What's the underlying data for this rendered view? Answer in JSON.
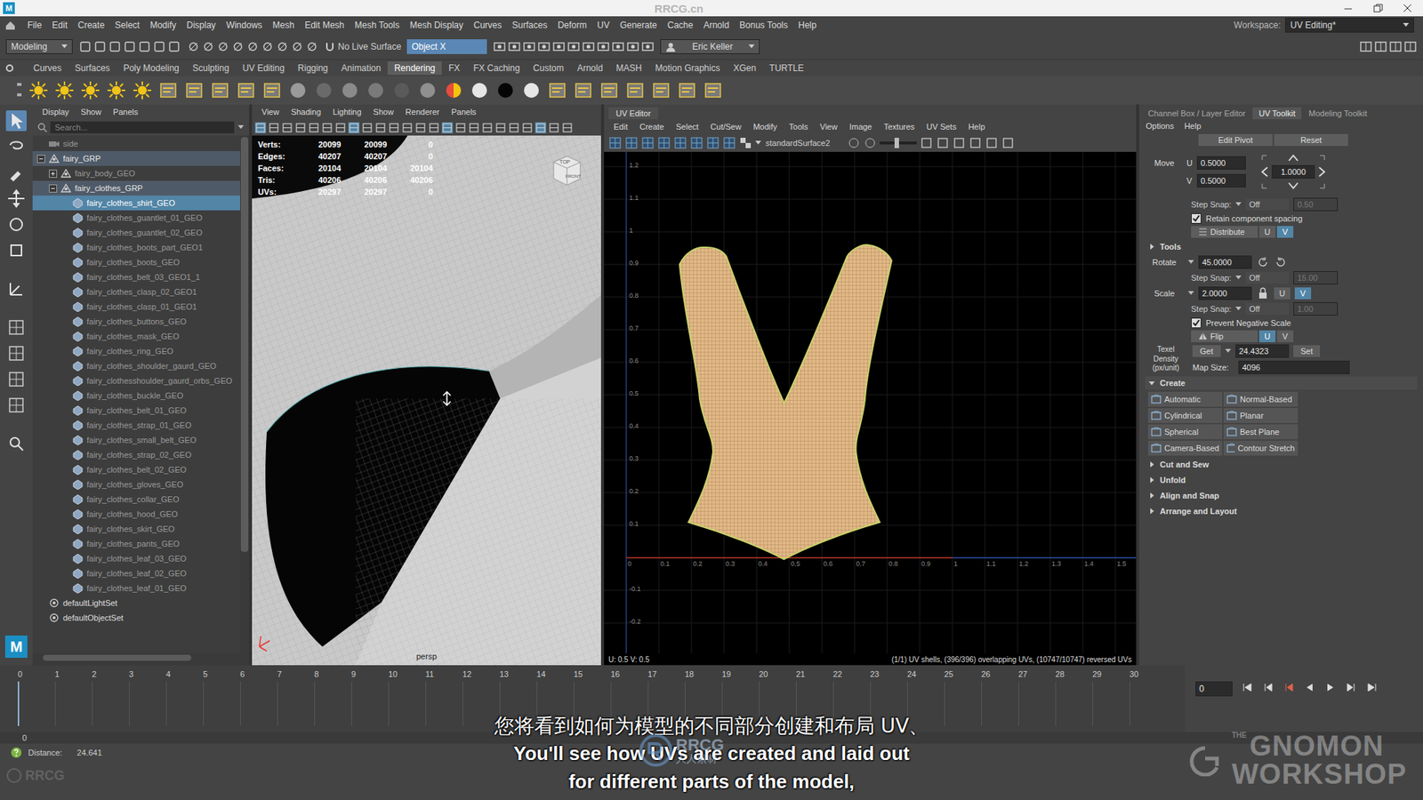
{
  "app_logo": "M",
  "titlebar": {
    "watermark": "RRCG.cn"
  },
  "menubar": {
    "items": [
      "File",
      "Edit",
      "Create",
      "Select",
      "Modify",
      "Display",
      "Windows",
      "Mesh",
      "Edit Mesh",
      "Mesh Tools",
      "Mesh Display",
      "Curves",
      "Surfaces",
      "Deform",
      "UV",
      "Generate",
      "Cache",
      "Arnold",
      "Bonus Tools",
      "Help"
    ],
    "workspace_label": "Workspace:",
    "workspace": "UV Editing*"
  },
  "statusline": {
    "mode": "Modeling",
    "live_surface": "No Live Surface",
    "symmetry": "Object X",
    "user": "Eric Keller"
  },
  "shelf": {
    "tabs": [
      {
        "label": "Curves",
        "selected": false
      },
      {
        "label": "Surfaces",
        "selected": false
      },
      {
        "label": "Poly Modeling",
        "selected": false
      },
      {
        "label": "Sculpting",
        "selected": false
      },
      {
        "label": "UV Editing",
        "selected": false
      },
      {
        "label": "Rigging",
        "selected": false
      },
      {
        "label": "Animation",
        "selected": false
      },
      {
        "label": "Rendering",
        "selected": true
      },
      {
        "label": "FX",
        "selected": false
      },
      {
        "label": "FX Caching",
        "selected": false
      },
      {
        "label": "Custom",
        "selected": false
      },
      {
        "label": "Arnold",
        "selected": false
      },
      {
        "label": "MASH",
        "selected": false
      },
      {
        "label": "Motion Graphics",
        "selected": false
      },
      {
        "label": "XGen",
        "selected": false
      },
      {
        "label": "TURTLE",
        "selected": false
      }
    ]
  },
  "outliner": {
    "menu": [
      "Display",
      "Show",
      "Panels"
    ],
    "search_placeholder": "Search...",
    "items": [
      {
        "label": "side",
        "depth": 0,
        "kind": "camera",
        "expanded": false,
        "selected": false,
        "highlighted": false,
        "dim": true
      },
      {
        "label": "fairy_GRP",
        "depth": 0,
        "kind": "group",
        "expanded": true,
        "selected": false,
        "highlighted": true,
        "dim": false
      },
      {
        "label": "fairy_body_GEO",
        "depth": 1,
        "kind": "group",
        "expanded": false,
        "selected": false,
        "highlighted": false,
        "dim": true
      },
      {
        "label": "fairy_clothes_GRP",
        "depth": 1,
        "kind": "group",
        "expanded": true,
        "selected": false,
        "highlighted": true,
        "dim": false
      },
      {
        "label": "fairy_clothes_shirt_GEO",
        "depth": 2,
        "kind": "mesh",
        "expanded": false,
        "selected": true,
        "highlighted": false,
        "dim": false
      },
      {
        "label": "fairy_clothes_guantlet_01_GEO",
        "depth": 2,
        "kind": "mesh",
        "expanded": false,
        "selected": false,
        "highlighted": false,
        "dim": true
      },
      {
        "label": "fairy_clothes_guantlet_02_GEO",
        "depth": 2,
        "kind": "mesh",
        "expanded": false,
        "selected": false,
        "highlighted": false,
        "dim": true
      },
      {
        "label": "fairy_clothes_boots_part_GEO1",
        "depth": 2,
        "kind": "mesh",
        "expanded": false,
        "selected": false,
        "highlighted": false,
        "dim": true
      },
      {
        "label": "fairy_clothes_boots_GEO",
        "depth": 2,
        "kind": "mesh",
        "expanded": false,
        "selected": false,
        "highlighted": false,
        "dim": true
      },
      {
        "label": "fairy_clothes_belt_03_GEO1_1",
        "depth": 2,
        "kind": "mesh",
        "expanded": false,
        "selected": false,
        "highlighted": false,
        "dim": true
      },
      {
        "label": "fairy_clothes_clasp_02_GEO1",
        "depth": 2,
        "kind": "mesh",
        "expanded": false,
        "selected": false,
        "highlighted": false,
        "dim": true
      },
      {
        "label": "fairy_clothes_clasp_01_GEO1",
        "depth": 2,
        "kind": "mesh",
        "expanded": false,
        "selected": false,
        "highlighted": false,
        "dim": true
      },
      {
        "label": "fairy_clothes_buttons_GEO",
        "depth": 2,
        "kind": "mesh",
        "expanded": false,
        "selected": false,
        "highlighted": false,
        "dim": true
      },
      {
        "label": "fairy_clothes_mask_GEO",
        "depth": 2,
        "kind": "mesh",
        "expanded": false,
        "selected": false,
        "highlighted": false,
        "dim": true
      },
      {
        "label": "fairy_clothes_ring_GEO",
        "depth": 2,
        "kind": "mesh",
        "expanded": false,
        "selected": false,
        "highlighted": false,
        "dim": true
      },
      {
        "label": "fairy_clothes_shoulder_gaurd_GEO",
        "depth": 2,
        "kind": "mesh",
        "expanded": false,
        "selected": false,
        "highlighted": false,
        "dim": true
      },
      {
        "label": "fairy_clothesshoulder_gaurd_orbs_GEO",
        "depth": 2,
        "kind": "mesh",
        "expanded": false,
        "selected": false,
        "highlighted": false,
        "dim": true
      },
      {
        "label": "fairy_clothes_buckle_GEO",
        "depth": 2,
        "kind": "mesh",
        "expanded": false,
        "selected": false,
        "highlighted": false,
        "dim": true
      },
      {
        "label": "fairy_clothes_belt_01_GEO",
        "depth": 2,
        "kind": "mesh",
        "expanded": false,
        "selected": false,
        "highlighted": false,
        "dim": true
      },
      {
        "label": "fairy_clothes_strap_01_GEO",
        "depth": 2,
        "kind": "mesh",
        "expanded": false,
        "selected": false,
        "highlighted": false,
        "dim": true
      },
      {
        "label": "fairy_clothes_small_belt_GEO",
        "depth": 2,
        "kind": "mesh",
        "expanded": false,
        "selected": false,
        "highlighted": false,
        "dim": true
      },
      {
        "label": "fairy_clothes_strap_02_GEO",
        "depth": 2,
        "kind": "mesh",
        "expanded": false,
        "selected": false,
        "highlighted": false,
        "dim": true
      },
      {
        "label": "fairy_clothes_belt_02_GEO",
        "depth": 2,
        "kind": "mesh",
        "expanded": false,
        "selected": false,
        "highlighted": false,
        "dim": true
      },
      {
        "label": "fairy_clothes_gloves_GEO",
        "depth": 2,
        "kind": "mesh",
        "expanded": false,
        "selected": false,
        "highlighted": false,
        "dim": true
      },
      {
        "label": "fairy_clothes_collar_GEO",
        "depth": 2,
        "kind": "mesh",
        "expanded": false,
        "selected": false,
        "highlighted": false,
        "dim": true
      },
      {
        "label": "fairy_clothes_hood_GEO",
        "depth": 2,
        "kind": "mesh",
        "expanded": false,
        "selected": false,
        "highlighted": false,
        "dim": true
      },
      {
        "label": "fairy_clothes_skirt_GEO",
        "depth": 2,
        "kind": "mesh",
        "expanded": false,
        "selected": false,
        "highlighted": false,
        "dim": true
      },
      {
        "label": "fairy_clothes_pants_GEO",
        "depth": 2,
        "kind": "mesh",
        "expanded": false,
        "selected": false,
        "highlighted": false,
        "dim": true
      },
      {
        "label": "fairy_clothes_leaf_03_GEO",
        "depth": 2,
        "kind": "mesh",
        "expanded": false,
        "selected": false,
        "highlighted": false,
        "dim": true
      },
      {
        "label": "fairy_clothes_leaf_02_GEO",
        "depth": 2,
        "kind": "mesh",
        "expanded": false,
        "selected": false,
        "highlighted": false,
        "dim": true
      },
      {
        "label": "fairy_clothes_leaf_01_GEO",
        "depth": 2,
        "kind": "mesh",
        "expanded": false,
        "selected": false,
        "highlighted": false,
        "dim": true
      },
      {
        "label": "defaultLightSet",
        "depth": 0,
        "kind": "set",
        "expanded": false,
        "selected": false,
        "highlighted": false,
        "dim": false
      },
      {
        "label": "defaultObjectSet",
        "depth": 0,
        "kind": "set",
        "expanded": false,
        "selected": false,
        "highlighted": false,
        "dim": false
      }
    ]
  },
  "viewport": {
    "menu": [
      "View",
      "Shading",
      "Lighting",
      "Show",
      "Renderer",
      "Panels"
    ],
    "hud": [
      {
        "label": "Verts:",
        "values": [
          "20099",
          "20099",
          "0"
        ]
      },
      {
        "label": "Edges:",
        "values": [
          "40207",
          "40207",
          "0"
        ]
      },
      {
        "label": "Faces:",
        "values": [
          "20104",
          "20104",
          "20104"
        ]
      },
      {
        "label": "Tris:",
        "values": [
          "40206",
          "40206",
          "40206"
        ]
      },
      {
        "label": "UVs:",
        "values": [
          "20297",
          "20297",
          "0"
        ]
      }
    ],
    "viewcube": {
      "top": "TOP",
      "front": "FRONT"
    },
    "camera": "persp"
  },
  "uv_editor": {
    "title": "UV Editor",
    "menu": [
      "Edit",
      "Create",
      "Select",
      "Cut/Sew",
      "Modify",
      "Tools",
      "View",
      "Image",
      "Textures",
      "UV Sets",
      "Help"
    ],
    "shader": "standardSurface2",
    "v_ticks": [
      "1.2",
      "1.1",
      "1",
      "0.9",
      "0.8",
      "0.7",
      "0.6",
      "0.5",
      "0.4",
      "0.3",
      "0.2",
      "0.1",
      "-0.1",
      "-0.2"
    ],
    "u_ticks": [
      "0",
      "0.1",
      "0.2",
      "0.3",
      "0.4",
      "0.5",
      "0.6",
      "0.7",
      "0.8",
      "0.9",
      "1",
      "1.1",
      "1.2",
      "1.3",
      "1.4",
      "1.5"
    ],
    "coords": "U: 0.5 V: 0.5",
    "stats": "(1/1) UV shells, (396/396) overlapping UVs, (10747/10747) reversed UVs"
  },
  "uv_toolkit": {
    "tabs": [
      {
        "label": "Channel Box / Layer Editor",
        "selected": false
      },
      {
        "label": "UV Toolkit",
        "selected": true
      },
      {
        "label": "Modeling Toolkit",
        "selected": false
      }
    ],
    "menu": [
      "Options",
      "Help"
    ],
    "pivot_buttons": [
      "Edit Pivot",
      "Reset"
    ],
    "move": {
      "label": "Move",
      "u_label": "U",
      "u": "0.5000",
      "v_label": "V",
      "v": "0.5000",
      "step": "1.0000"
    },
    "move_snap": {
      "label": "Step Snap:",
      "mode": "Off",
      "value": "0.50"
    },
    "retain": {
      "label": "Retain component spacing",
      "checked": true
    },
    "distribute": {
      "label": "Distribute",
      "axes": [
        {
          "label": "U",
          "selected": false
        },
        {
          "label": "V",
          "selected": true
        }
      ]
    },
    "tools_header": {
      "label": "Tools",
      "expanded": false
    },
    "rotate": {
      "label": "Rotate",
      "value": "45.0000"
    },
    "rotate_snap": {
      "label": "Step Snap:",
      "mode": "Off",
      "value": "15.00"
    },
    "scale": {
      "label": "Scale",
      "value": "2.0000",
      "axes": [
        {
          "label": "U",
          "selected": false
        },
        {
          "label": "V",
          "selected": true
        }
      ]
    },
    "scale_snap": {
      "label": "Step Snap:",
      "mode": "Off",
      "value": "1.00"
    },
    "prevent": {
      "label": "Prevent Negative Scale",
      "checked": true
    },
    "flip": {
      "label": "Flip",
      "axes": [
        {
          "label": "U",
          "selected": true
        },
        {
          "label": "V",
          "selected": false
        }
      ]
    },
    "texel": {
      "label": "Texel Density (px/unit)",
      "get": "Get",
      "value": "24.4323",
      "set": "Set",
      "map_label": "Map Size:",
      "map_size": "4096"
    },
    "create": {
      "label": "Create",
      "expanded": true,
      "buttons": [
        "Automatic",
        "Normal-Based",
        "Cylindrical",
        "Planar",
        "Spherical",
        "Best Plane",
        "Camera-Based",
        "Contour Stretch"
      ]
    },
    "sections": [
      {
        "label": "Cut and Sew",
        "expanded": false
      },
      {
        "label": "Unfold",
        "expanded": false
      },
      {
        "label": "Align and Snap",
        "expanded": false
      },
      {
        "label": "Arrange and Layout",
        "expanded": false
      }
    ]
  },
  "timeline": {
    "frames": [
      "0",
      "1",
      "2",
      "3",
      "4",
      "5",
      "6",
      "7",
      "8",
      "9",
      "10",
      "11",
      "12",
      "13",
      "14",
      "15",
      "16",
      "17",
      "18",
      "19",
      "20",
      "21",
      "22",
      "23",
      "24",
      "25",
      "26",
      "27",
      "28",
      "29",
      "30"
    ],
    "current_frame": "0",
    "range_start": "0"
  },
  "helpline": {
    "label": "Distance:",
    "value": "24.641"
  },
  "subtitles": {
    "zh": "您将看到如何为模型的不同部分创建和布局 UV、",
    "en": "You'll see how UVs are created and laid out for different parts of the model,"
  },
  "watermarks": {
    "center": "RRCG",
    "center_cn": "人人素材",
    "corner": "RRCG",
    "brand_top": "THE",
    "brand_main": "GNOMON",
    "brand_sub": "WORKSHOP"
  }
}
